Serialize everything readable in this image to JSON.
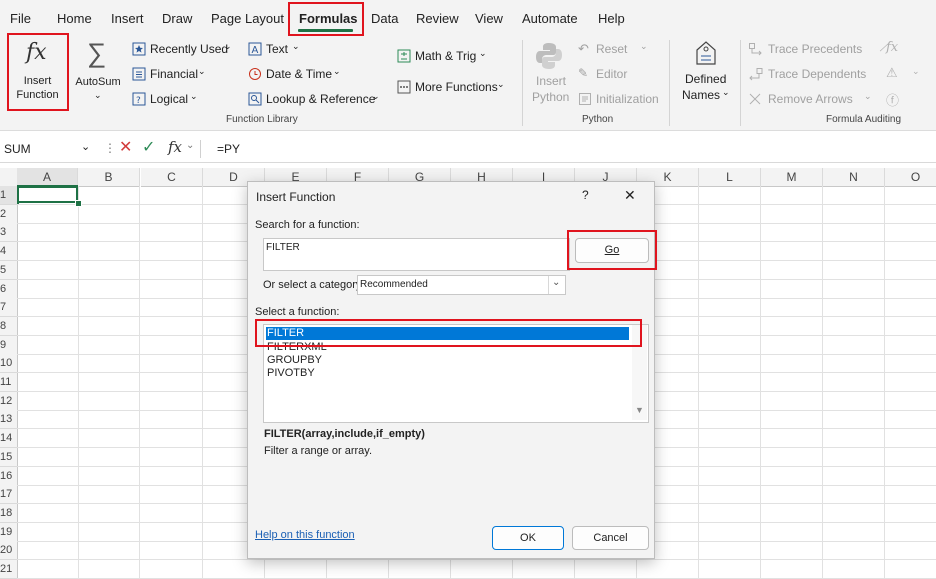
{
  "menu": {
    "tabs": [
      "File",
      "Home",
      "Insert",
      "Draw",
      "Page Layout",
      "Formulas",
      "Data",
      "Review",
      "View",
      "Automate",
      "Help"
    ],
    "active": "Formulas"
  },
  "ribbon": {
    "insert_function": {
      "line1": "Insert",
      "line2": "Function",
      "glyph": "fx"
    },
    "autosum": {
      "label": "AutoSum",
      "glyph": "∑"
    },
    "library_col1": [
      "Recently Used",
      "Financial",
      "Logical"
    ],
    "library_col2": [
      "Text",
      "Date & Time",
      "Lookup & Reference"
    ],
    "library_col3": [
      "Math & Trig",
      "More Functions"
    ],
    "function_library_label": "Function Library",
    "python": {
      "insert_line1": "Insert",
      "insert_line2": "Python",
      "reset": "Reset",
      "editor": "Editor",
      "initialization": "Initialization",
      "group_label": "Python"
    },
    "defined_names": {
      "line1": "Defined",
      "line2": "Names"
    },
    "auditing": {
      "trace_precedents": "Trace Precedents",
      "trace_dependents": "Trace Dependents",
      "remove_arrows": "Remove Arrows",
      "group_label": "Formula Auditing"
    }
  },
  "formula_bar": {
    "name_box": "SUM",
    "fx_glyph": "fx",
    "formula": "=PY"
  },
  "grid": {
    "columns": [
      "A",
      "B",
      "C",
      "D",
      "E",
      "F",
      "G",
      "H",
      "I",
      "J",
      "K",
      "L",
      "M",
      "N",
      "O"
    ],
    "rows": [
      "1",
      "2",
      "3",
      "4",
      "5",
      "6",
      "7",
      "8",
      "9",
      "10",
      "11",
      "12",
      "13",
      "14",
      "15",
      "16",
      "17",
      "18",
      "19",
      "20",
      "21"
    ]
  },
  "dialog": {
    "title": "Insert Function",
    "help_glyph": "?",
    "close_glyph": "✕",
    "search_label": "Search for a function:",
    "search_value": "FILTER",
    "go_button": "Go",
    "category_label": "Or select a category:",
    "category_value": "Recommended",
    "select_label": "Select a function:",
    "functions": [
      "FILTER",
      "FILTERXML",
      "GROUPBY",
      "PIVOTBY"
    ],
    "selected_function": "FILTER",
    "signature": "FILTER(array,include,if_empty)",
    "description": "Filter a range or array.",
    "help_link": "Help on this function",
    "ok_button": "OK",
    "cancel_button": "Cancel"
  },
  "colors": {
    "accent": "#1e7145",
    "highlight": "#e0141e",
    "selection": "#0078d7"
  }
}
